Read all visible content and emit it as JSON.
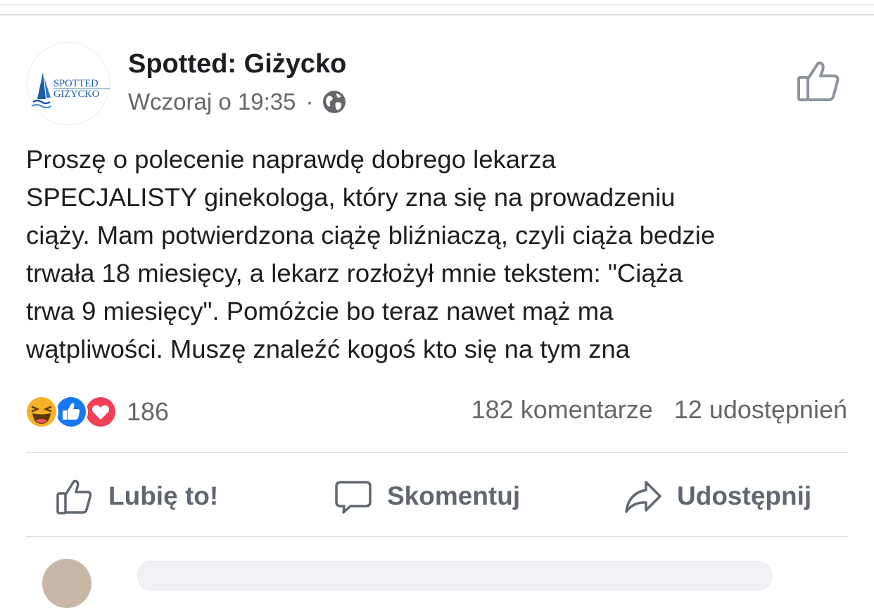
{
  "post": {
    "page_name": "Spotted: Giżycko",
    "timestamp": "Wczoraj o 19:35",
    "separator": "·",
    "privacy_icon": "globe-icon",
    "avatar": {
      "logo_line1": "SPOTTED",
      "logo_line2": "GIŻYCKO",
      "logo_color": "#1e5aa8"
    },
    "text_lines": [
      "Proszę o polecenie naprawdę dobrego lekarza",
      "SPECJALISTY ginekologa, który zna się na prowadzeniu",
      "ciąży. Mam potwierdzona ciążę bliźniaczą, czyli ciąża bedzie",
      "trwała 18 miesięcy, a lekarz rozłożył mnie tekstem: \"Ciąża",
      "trwa 9 miesięcy\". Pomóżcie bo teraz nawet mąż ma",
      "wątpliwości. Muszę znaleźć kogoś kto się na tym zna"
    ]
  },
  "reactions": {
    "icons": [
      "haha-icon",
      "like-reaction-icon",
      "love-icon"
    ],
    "count": "186"
  },
  "stats": {
    "comments": "182 komentarze",
    "shares": "12 udostępnień"
  },
  "actions": {
    "like_label": "Lubię to!",
    "comment_label": "Skomentuj",
    "share_label": "Udostępnij"
  },
  "colors": {
    "text": "#1c1e21",
    "secondary": "#65676b",
    "action": "#606770",
    "like_blue": "#1877f2",
    "love_red": "#f33e58",
    "haha_yellow": "#f7b125"
  }
}
